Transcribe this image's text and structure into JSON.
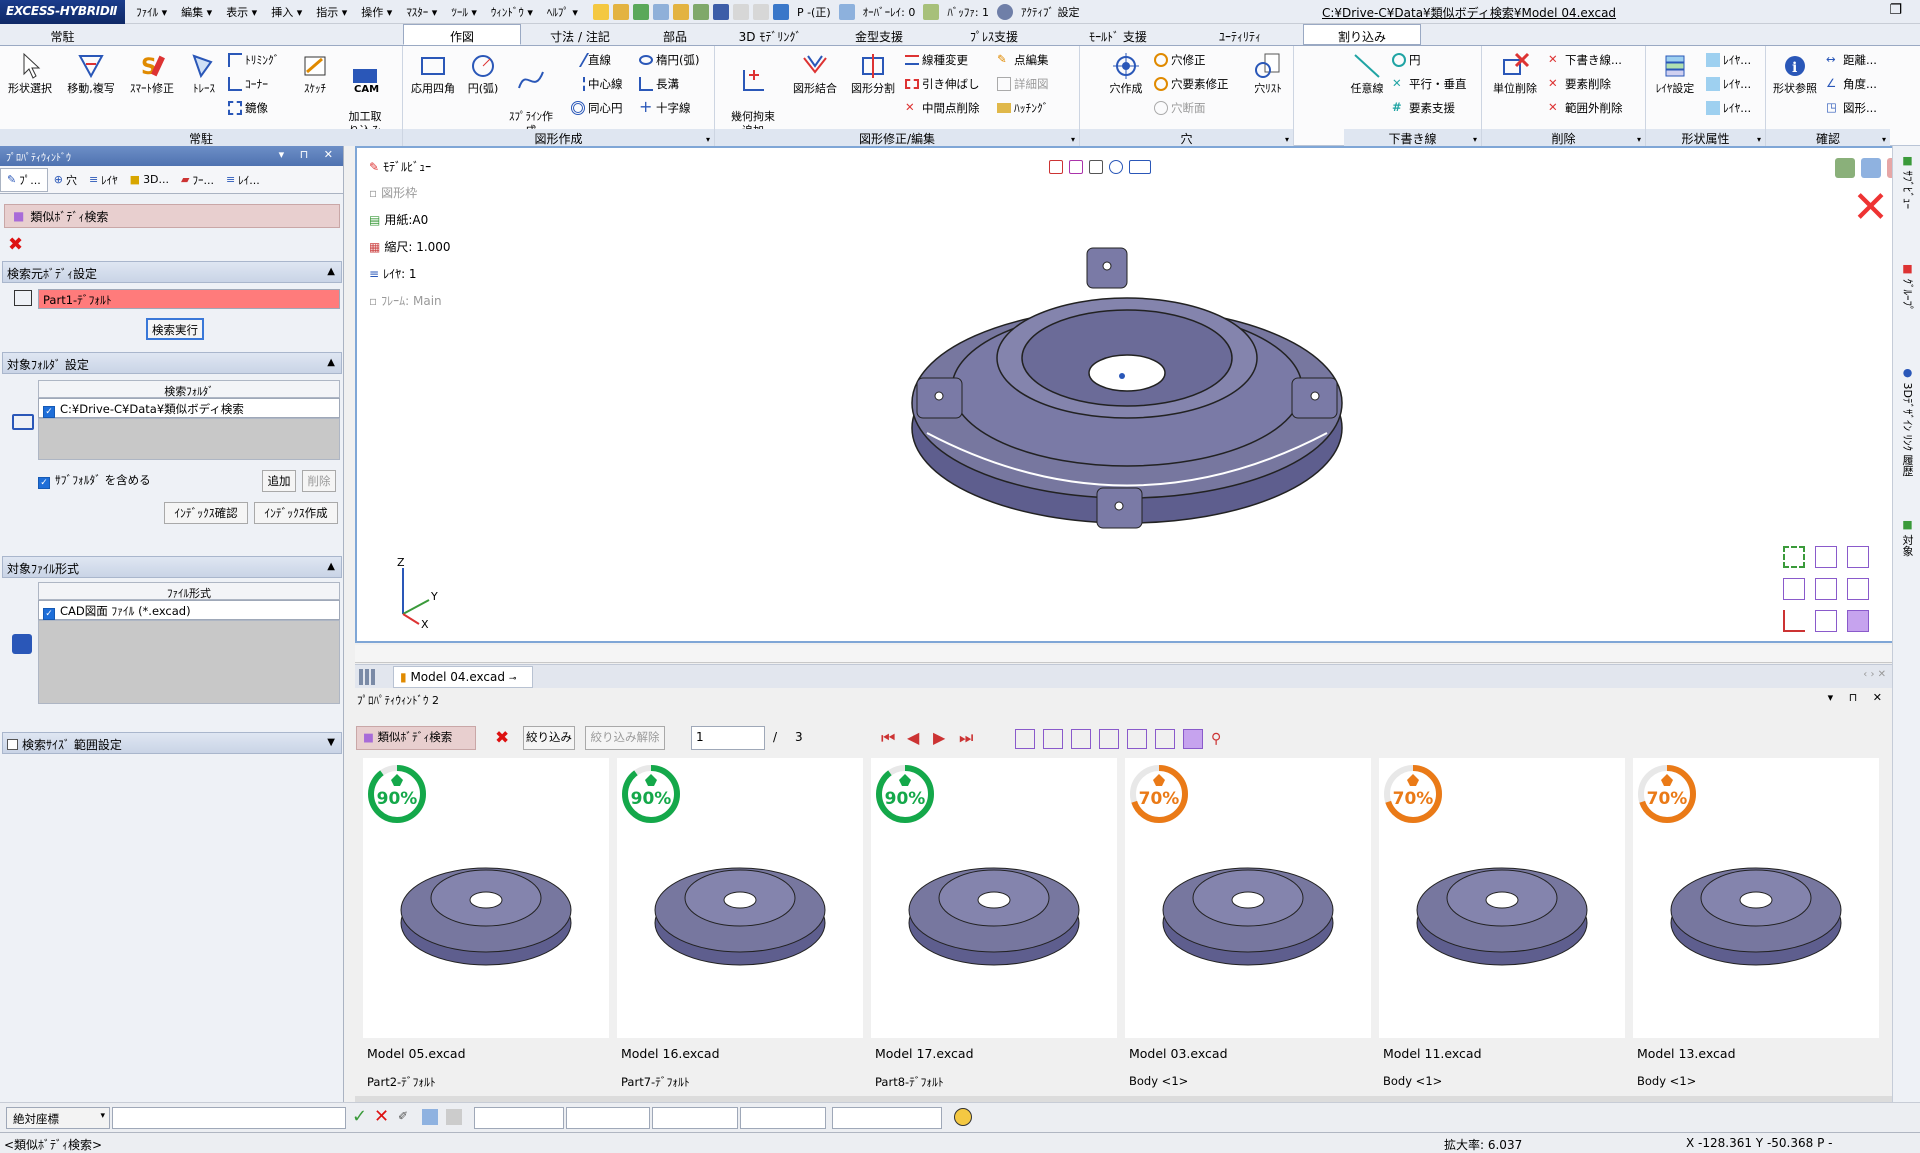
{
  "app": {
    "logo": "EXCESS-HYBRIDⅡ",
    "menu": [
      "ﾌｧｲﾙ ▾",
      "編集 ▾",
      "表示 ▾",
      "挿入 ▾",
      "指示 ▾",
      "操作 ▾",
      "ﾏｽﾀｰ ▾",
      "ﾂｰﾙ ▾",
      "ｳｨﾝﾄﾞｳ ▾",
      "ﾍﾙﾌﾟ ▾"
    ],
    "quick": {
      "p_mode": "P -(正)",
      "overlay": "ｵｰﾊﾞｰﾚｲ: 0",
      "buffer": "ﾊﾞｯﾌｧ: 1",
      "active": "ｱｸﾃｨﾌﾞ 設定"
    },
    "doc_path": "C:¥Drive-C¥Data¥類似ボディ検索¥Model 04.excad"
  },
  "ribbon_tabs": [
    "常駐",
    "作図",
    "寸法 / 注記",
    "部品",
    "3D ﾓﾃﾞﾘﾝｸﾞ",
    "金型支援",
    "ﾌﾟﾚｽ支援",
    "ﾓｰﾙﾄﾞ 支援",
    "ﾕｰﾃｨﾘﾃｨ",
    "割り込み"
  ],
  "ribbon": {
    "g1": {
      "label": "常駐",
      "b1": "形状選択",
      "b2": "移動,複写",
      "b3": "ｽﾏｰﾄ修正",
      "b4": "ﾄﾚｰｽ",
      "s1": "ﾄﾘﾐﾝｸﾞ",
      "s2": "ｺｰﾅｰ",
      "s3": "鏡像",
      "b5": "ｽｹｯﾁ",
      "b6": "加工取\nり込み",
      "cam": "CAM"
    },
    "g2": {
      "label": "図形作成",
      "b1": "応用四角",
      "b2": "円(弧)",
      "b3": "ｽﾌﾟﾗｲﾝ作\n成",
      "s1": "直線",
      "s2": "中心線",
      "s3": "同心円",
      "s4": "楕円(弧)",
      "s5": "長溝",
      "s6": "十字線"
    },
    "g3": {
      "label": "図形修正/編集",
      "b1": "幾何拘束\n追加",
      "b2": "図形結合",
      "b3": "図形分割",
      "s1": "線種変更",
      "s2": "引き伸ばし",
      "s3": "中間点削除",
      "s4": "点編集",
      "s5": "詳細図",
      "s6": "ﾊｯﾁﾝｸﾞ"
    },
    "g4": {
      "label": "穴",
      "b1": "穴作成",
      "b2": "穴ﾘｽﾄ",
      "s1": "穴修正",
      "s2": "穴要素修正",
      "s3": "穴断面"
    },
    "g5": {
      "label": "下書き線",
      "b1": "任意線",
      "s1": "円",
      "s2": "平行・垂直",
      "s3": "要素支援"
    },
    "g6": {
      "label": "削除",
      "b1": "単位削除",
      "s1": "下書き線...",
      "s2": "要素削除",
      "s3": "範囲外削除"
    },
    "g7": {
      "label": "形状属性",
      "b1": "ﾚｲﾔ設定",
      "s1": "ﾚｲﾔ...",
      "s2": "ﾚｲﾔ...",
      "s3": "ﾚｲﾔ..."
    },
    "g8": {
      "label": "確認",
      "b1": "形状参照",
      "s1": "距離...",
      "s2": "角度...",
      "s3": "図形..."
    }
  },
  "left_panel": {
    "title": "ﾌﾟﾛﾊﾟﾃｨｳｨﾝﾄﾞｳ",
    "tabs": [
      "ﾌﾟ...",
      "穴",
      "ﾚｲﾔ",
      "3D...",
      "ﾌｰ...",
      "ﾚｲ..."
    ],
    "search_title": "類似ﾎﾞﾃﾞｨ検索",
    "sec1": {
      "title": "検索元ﾎﾞﾃﾞｨ設定",
      "field": "Part1-ﾃﾞﾌｫﾙﾄ",
      "button": "検索実行"
    },
    "sec2": {
      "title": "対象ﾌｫﾙﾀﾞ 設定",
      "col": "検索ﾌｫﾙﾀﾞ",
      "row": "C:¥Drive-C¥Data¥類似ボディ検索",
      "subfolder": "ｻﾌﾞﾌｫﾙﾀﾞ を含める",
      "add": "追加",
      "delete": "削除",
      "idx_check": "ｲﾝﾃﾞｯｸｽ確認",
      "idx_make": "ｲﾝﾃﾞｯｸｽ作成"
    },
    "sec3": {
      "title": "対象ﾌｧｲﾙ形式",
      "col": "ﾌｧｲﾙ形式",
      "row": "CAD図面 ﾌｧｲﾙ (*.excad)"
    },
    "sec4": {
      "title": "検索ｻｲｽﾞ 範囲設定"
    }
  },
  "viewport": {
    "model_view": "ﾓﾃﾞﾙﾋﾞｭｰ",
    "frame": "図形枠",
    "paper": "用紙:A0",
    "scale": "縮尺: 1.000",
    "layer": "ﾚｲﾔ: 1",
    "frame_main": "ﾌﾚｰﾑ: Main",
    "axis": {
      "x": "X",
      "y": "Y",
      "z": "Z"
    }
  },
  "right_strip": [
    "ｻﾌﾞﾋﾞｭｰ",
    "ｸﾞﾙｰﾌﾟ",
    "3Dﾃﾞｻﾞｲﾝ ﾘﾝｸ 履歴",
    "対象"
  ],
  "doc_tab": "Model 04.excad",
  "bottom_panel": {
    "title": "ﾌﾟﾛﾊﾟﾃｨｳｨﾝﾄﾞｳ 2",
    "search_btn": "類似ﾎﾞﾃﾞｨ検索",
    "filter": "絞り込み",
    "filter_clear": "絞り込み解除",
    "page": "1",
    "page_sep": "/",
    "page_total": "3",
    "results": [
      {
        "pct": "90%",
        "score": 0.9,
        "color": "#14a84a",
        "file": "Model 05.excad",
        "body": "Part2-ﾃﾞﾌｫﾙﾄ"
      },
      {
        "pct": "90%",
        "score": 0.9,
        "color": "#14a84a",
        "file": "Model 16.excad",
        "body": "Part7-ﾃﾞﾌｫﾙﾄ"
      },
      {
        "pct": "90%",
        "score": 0.9,
        "color": "#14a84a",
        "file": "Model 17.excad",
        "body": "Part8-ﾃﾞﾌｫﾙﾄ"
      },
      {
        "pct": "70%",
        "score": 0.7,
        "color": "#ea7a17",
        "file": "Model 03.excad",
        "body": "Body <1>"
      },
      {
        "pct": "70%",
        "score": 0.7,
        "color": "#ea7a17",
        "file": "Model 11.excad",
        "body": "Body <1>"
      },
      {
        "pct": "70%",
        "score": 0.7,
        "color": "#ea7a17",
        "file": "Model 13.excad",
        "body": "Body <1>"
      }
    ]
  },
  "cmdbar": {
    "coord_mode": "絶対座標"
  },
  "status": {
    "left": "<類似ﾎﾞﾃﾞｨ検索>",
    "zoom": "拡大率: 6.037",
    "coords": "X -128.361 Y -50.368  P -"
  },
  "colors": {
    "model": "#6f6f9e",
    "accent": "#1b3c8c",
    "highlight": "#ff7b7b"
  }
}
